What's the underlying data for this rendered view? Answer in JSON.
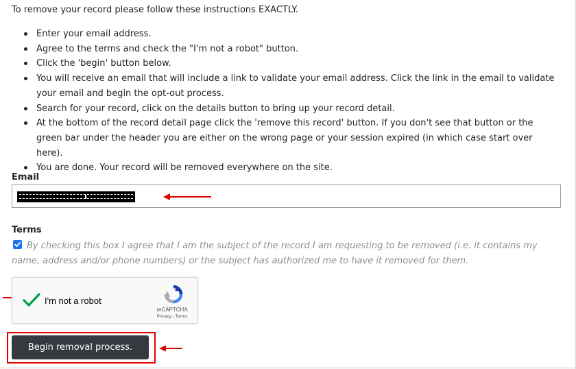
{
  "instructions": {
    "intro": "To remove your record please follow these instructions EXACTLY.",
    "steps": [
      "Enter your email address.",
      "Agree to the terms and check the \"I'm not a robot\" button.",
      "Click the 'begin' button below.",
      "You will receive an email that will include a link to validate your email address. Click the link in the email to validate your email and begin the opt-out process.",
      "Search for your record, click on the details button to bring up your record detail.",
      "At the bottom of the record detail page click the 'remove this record' button. If you don't see that button or the green bar under the header you are either on the wrong page or your session expired (in which case start over here).",
      "You are done. Your record will be removed everywhere on the site."
    ]
  },
  "form": {
    "email_label": "Email",
    "email_value_state": "redacted",
    "terms_label": "Terms",
    "terms_checked": true,
    "terms_text": "By checking this box I agree that I am the subject of the record I am requesting to be removed (i.e. it contains my name, address and/or phone numbers) or the subject has authorized me to have it removed for them.",
    "submit_label": "Begin removal process."
  },
  "recaptcha": {
    "checked": true,
    "label": "I'm not a robot",
    "brand": "reCAPTCHA",
    "privacy_label": "Privacy",
    "separator": " - ",
    "terms_label": "Terms"
  },
  "annotations": {
    "arrow_color": "#e00000",
    "highlight_color": "#e00000"
  },
  "colors": {
    "button_bg": "#343a40",
    "checkbox_blue": "#1a73e8",
    "robot_check_green": "#009c48",
    "terms_text": "#8a8f94"
  }
}
